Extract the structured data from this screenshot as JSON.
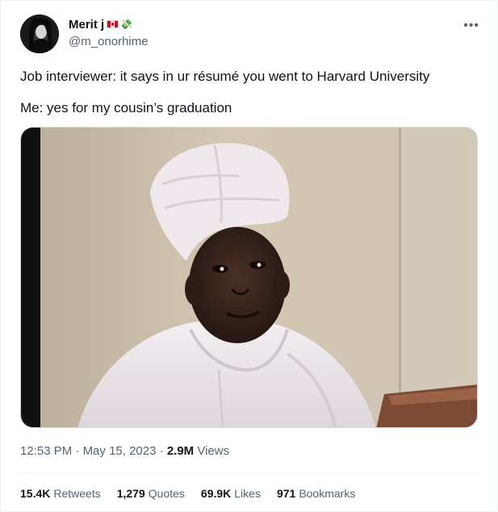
{
  "author": {
    "name": "Merit j",
    "emoji": "💸",
    "handle": "@m_onorhime",
    "flag_colors": [
      "#d80621",
      "#ffffff",
      "#d80621"
    ]
  },
  "more_icon": "•••",
  "tweet": {
    "line1": "Job interviewer: it says in ur résumé you went to Harvard University",
    "line2": "Me: yes for my cousin’s graduation"
  },
  "meta": {
    "time": "12:53 PM",
    "sep1": " · ",
    "date": "May 15, 2023",
    "sep2": " · ",
    "views_count": "2.9M",
    "views_label": " Views"
  },
  "stats": [
    {
      "count": "15.4K",
      "label": "Retweets"
    },
    {
      "count": "1,279",
      "label": "Quotes"
    },
    {
      "count": "69.9K",
      "label": "Likes"
    },
    {
      "count": "971",
      "label": "Bookmarks"
    }
  ],
  "colors": {
    "text": "#0f1419",
    "secondary": "#536471",
    "border": "#eff3f4"
  }
}
